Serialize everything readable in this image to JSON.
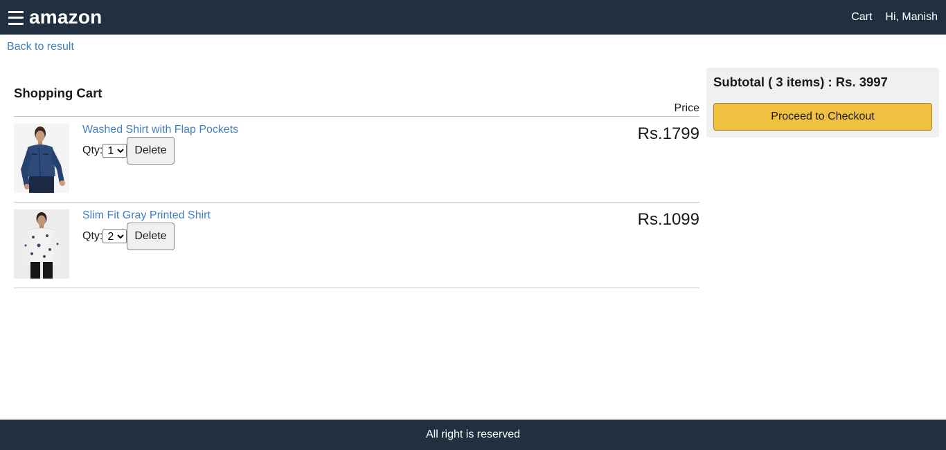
{
  "header": {
    "brand": "amazon",
    "cart_label": "Cart",
    "user_label": "Hi, Manish"
  },
  "back_link": "Back to result",
  "cart": {
    "title": "Shopping Cart",
    "price_header": "Price",
    "qty_label": "Qty:",
    "delete_label": "Delete",
    "items": [
      {
        "name": "Washed Shirt with Flap Pockets",
        "qty": "1",
        "price": "Rs.1799"
      },
      {
        "name": "Slim Fit Gray Printed Shirt",
        "qty": "2",
        "price": "Rs.1099"
      }
    ]
  },
  "summary": {
    "subtotal": "Subtotal ( 3 items) : Rs. 3997",
    "checkout_label": "Proceed to Checkout"
  },
  "footer": {
    "text": "All right is reserved"
  },
  "colors": {
    "header_bg": "#203040",
    "link": "#3f7fbf",
    "checkout_button": "#f0c040",
    "summary_bg": "#f0f0f0"
  }
}
